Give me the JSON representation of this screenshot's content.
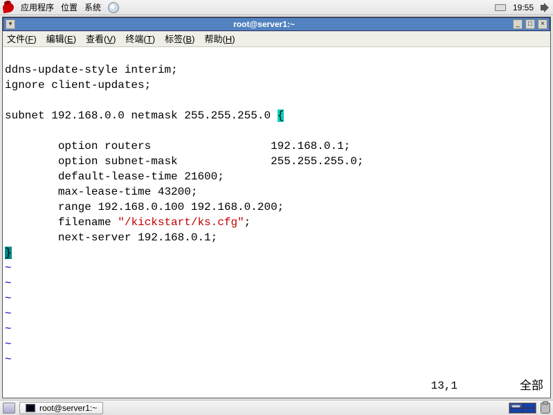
{
  "top_panel": {
    "menus": [
      "应用程序",
      "位置",
      "系统"
    ],
    "clock": "19:55"
  },
  "window": {
    "title": "root@server1:~",
    "menubar": [
      {
        "label": "文件",
        "key": "F"
      },
      {
        "label": "编辑",
        "key": "E"
      },
      {
        "label": "查看",
        "key": "V"
      },
      {
        "label": "终端",
        "key": "T"
      },
      {
        "label": "标签",
        "key": "B"
      },
      {
        "label": "帮助",
        "key": "H"
      }
    ]
  },
  "editor": {
    "lines": {
      "l1": "ddns-update-style interim;",
      "l2": "ignore client-updates;",
      "l3": "",
      "l4a": "subnet 192.168.0.0 netmask 255.255.255.0 ",
      "l4b": "{",
      "l5": "",
      "l6": "        option routers                  192.168.0.1;",
      "l7": "        option subnet-mask              255.255.255.0;",
      "l8": "        default-lease-time 21600;",
      "l9": "        max-lease-time 43200;",
      "l10": "        range 192.168.0.100 192.168.0.200;",
      "l11a": "        filename ",
      "l11b": "\"/kickstart/ks.cfg\"",
      "l11c": ";",
      "l12": "        next-server 192.168.0.1;",
      "l13": "}",
      "tilde": "~"
    },
    "status": {
      "position": "13,1",
      "mode": "全部"
    }
  },
  "bottom_panel": {
    "task": "root@server1:~"
  }
}
